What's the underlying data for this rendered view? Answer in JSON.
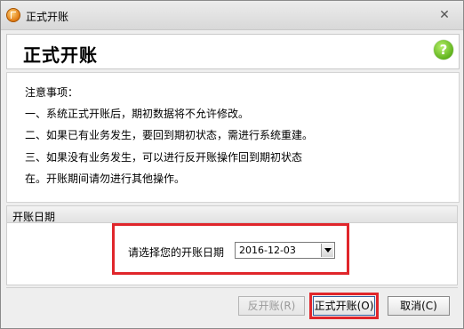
{
  "window": {
    "title": "正式开账",
    "close_glyph": "✕"
  },
  "header": {
    "title": "正式开账",
    "help_glyph": "?"
  },
  "notes": {
    "heading": "注意事项：",
    "line1": "一、系统正式开账后，期初数据将不允许修改。",
    "line2": "二、如果已有业务发生，要回到期初状态，需进行系统重建。",
    "line3": "三、如果没有业务发生，可以进行反开账操作回到期初状态",
    "line4": "在。开账期间请勿进行其他操作。"
  },
  "open_date_group": {
    "label": "开账日期",
    "prompt": "请选择您的开账日期",
    "selected_date": "2016-12-03"
  },
  "buttons": {
    "reverse_open": "反开账(R)",
    "formal_open": "正式开账(O)",
    "cancel": "取消(C)"
  },
  "colors": {
    "highlight_red": "#e0262b",
    "help_green": "#5fb21c",
    "app_orange": "#e07a12"
  },
  "icons": {
    "app": "app-logo-icon",
    "close": "close-icon",
    "help": "help-icon",
    "dropdown": "chevron-down-icon"
  }
}
